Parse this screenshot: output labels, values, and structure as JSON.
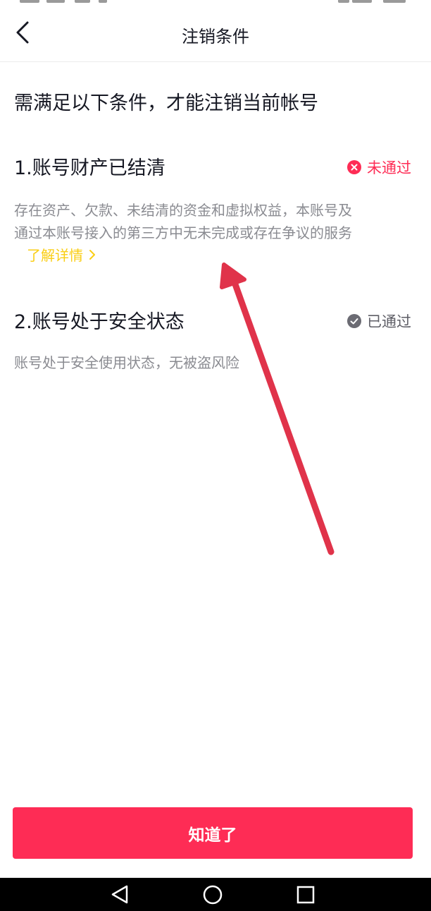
{
  "nav": {
    "title": "注销条件",
    "back_icon": "chevron-left-icon"
  },
  "intro": "需满足以下条件，才能注销当前帐号",
  "conditions": [
    {
      "title": "1.账号财产已结清",
      "status_label": "未通过",
      "status_icon": "close-circle-icon",
      "status_color": "#fe2c55",
      "description_lines": [
        "存在资产、欠款、未结清的资金和虚拟权益，本账号及",
        "通过本账号接入的第三方中无未完成或存在争议的服务"
      ],
      "link_label": "了解详情",
      "link_icon": "chevron-right-icon",
      "link_color": "#face15"
    },
    {
      "title": "2.账号处于安全状态",
      "status_label": "已通过",
      "status_icon": "check-circle-icon",
      "status_color": "#5e5e66",
      "description_lines": [
        "账号处于安全使用状态，无被盗风险"
      ]
    }
  ],
  "annotation": {
    "icon": "red-arrow-annotation",
    "color": "#e0334a"
  },
  "primary_button": {
    "label": "知道了",
    "color": "#fe2c55"
  },
  "system_nav": {
    "back_icon": "triangle-back-icon",
    "home_icon": "circle-home-icon",
    "recents_icon": "square-recents-icon"
  }
}
